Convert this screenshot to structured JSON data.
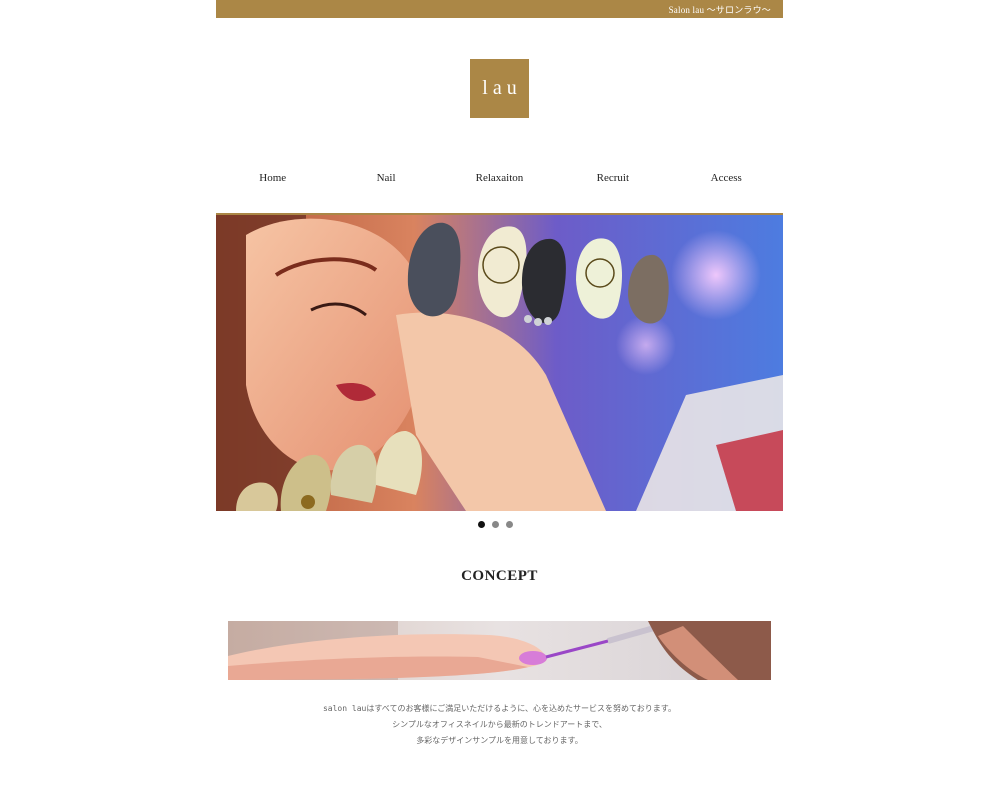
{
  "header": {
    "top_text": "Salon lau 〜サロンラウ〜",
    "logo": "lau",
    "brand_color": "#ab8746"
  },
  "nav": {
    "items": [
      "Home",
      "Nail",
      "Relaxaiton",
      "Recruit",
      "Access"
    ]
  },
  "slider": {
    "slide_count": 3,
    "active_index": 0
  },
  "concept": {
    "title": "CONCEPT",
    "lines": [
      "salon lauはすべてのお客様にご満足いただけるように、心を込めたサービスを努めております。",
      "シンプルなオフィスネイルから最新のトレンドアートまで、",
      "多彩なデザインサンプルを用意しております。"
    ]
  }
}
